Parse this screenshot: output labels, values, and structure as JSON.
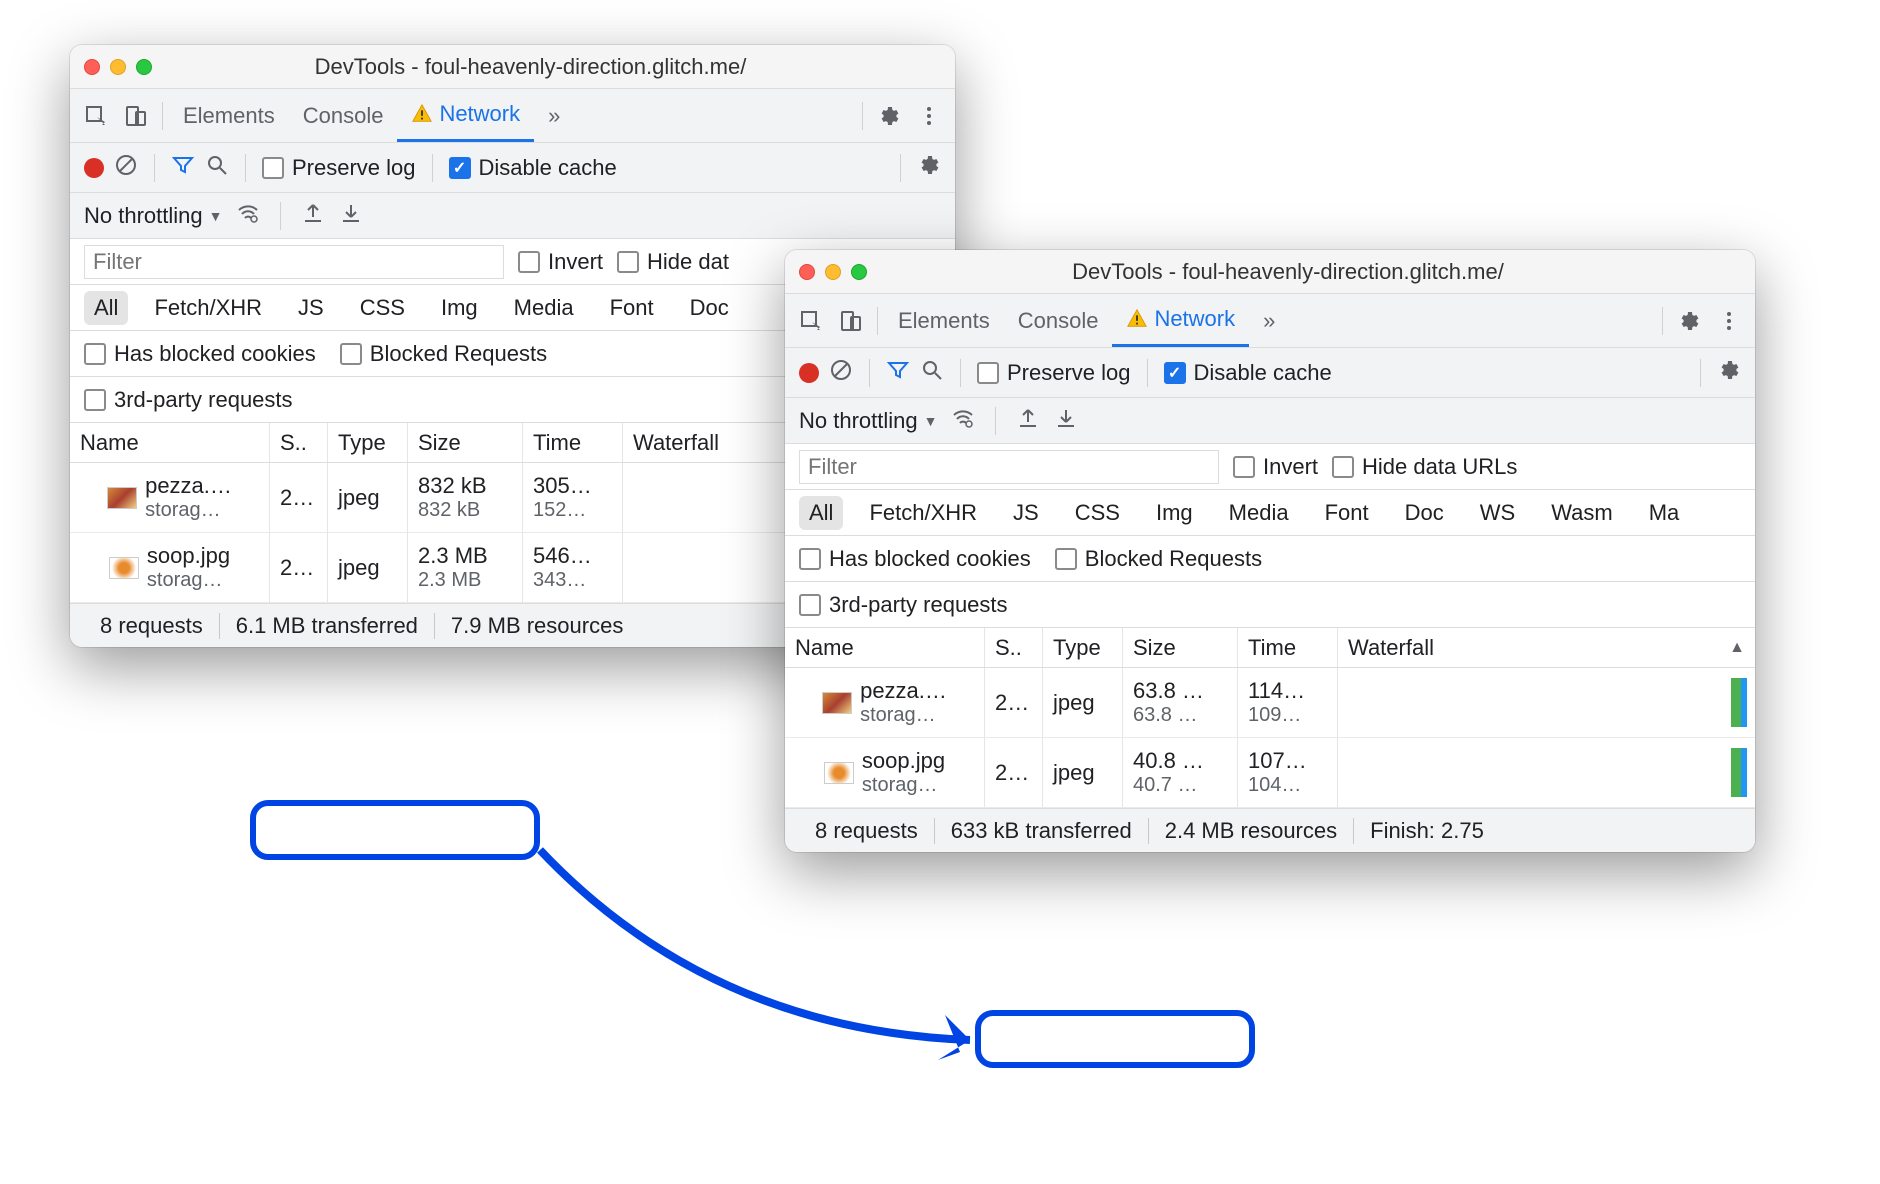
{
  "window_a": {
    "title": "DevTools - foul-heavenly-direction.glitch.me/",
    "tabs": {
      "elements": "Elements",
      "console": "Console",
      "network": "Network",
      "more": "»"
    },
    "toolbar": {
      "preserve_log": "Preserve log",
      "disable_cache": "Disable cache"
    },
    "throttle": {
      "label": "No throttling"
    },
    "filter": {
      "placeholder": "Filter",
      "invert": "Invert",
      "hide_data": "Hide dat"
    },
    "types": {
      "all": "All",
      "fetch": "Fetch/XHR",
      "js": "JS",
      "css": "CSS",
      "img": "Img",
      "media": "Media",
      "font": "Font",
      "doc": "Doc"
    },
    "subchecks": {
      "blocked_cookies": "Has blocked cookies",
      "blocked_requests": "Blocked Requests",
      "third_party": "3rd-party requests"
    },
    "columns": {
      "name": "Name",
      "status": "S..",
      "type": "Type",
      "size": "Size",
      "time": "Time",
      "waterfall": "Waterfall"
    },
    "rows": [
      {
        "name": "pezza.…",
        "domain": "storag…",
        "status": "2…",
        "type": "jpeg",
        "size": "832 kB",
        "size2": "832 kB",
        "time": "305…",
        "time2": "152…"
      },
      {
        "name": "soop.jpg",
        "domain": "storag…",
        "status": "2…",
        "type": "jpeg",
        "size": "2.3 MB",
        "size2": "2.3 MB",
        "time": "546…",
        "time2": "343…"
      }
    ],
    "footer": {
      "requests": "8 requests",
      "transferred": "6.1 MB transferred",
      "resources": "7.9 MB resources"
    }
  },
  "window_b": {
    "title": "DevTools - foul-heavenly-direction.glitch.me/",
    "tabs": {
      "elements": "Elements",
      "console": "Console",
      "network": "Network",
      "more": "»"
    },
    "toolbar": {
      "preserve_log": "Preserve log",
      "disable_cache": "Disable cache"
    },
    "throttle": {
      "label": "No throttling"
    },
    "filter": {
      "placeholder": "Filter",
      "invert": "Invert",
      "hide_data": "Hide data URLs"
    },
    "types": {
      "all": "All",
      "fetch": "Fetch/XHR",
      "js": "JS",
      "css": "CSS",
      "img": "Img",
      "media": "Media",
      "font": "Font",
      "doc": "Doc",
      "ws": "WS",
      "wasm": "Wasm",
      "ma": "Ma"
    },
    "subchecks": {
      "blocked_cookies": "Has blocked cookies",
      "blocked_requests": "Blocked Requests",
      "third_party": "3rd-party requests"
    },
    "columns": {
      "name": "Name",
      "status": "S..",
      "type": "Type",
      "size": "Size",
      "time": "Time",
      "waterfall": "Waterfall"
    },
    "rows": [
      {
        "name": "pezza.…",
        "domain": "storag…",
        "status": "2…",
        "type": "jpeg",
        "size": "63.8 …",
        "size2": "63.8 …",
        "time": "114…",
        "time2": "109…"
      },
      {
        "name": "soop.jpg",
        "domain": "storag…",
        "status": "2…",
        "type": "jpeg",
        "size": "40.8 …",
        "size2": "40.7 …",
        "time": "107…",
        "time2": "104…"
      }
    ],
    "footer": {
      "requests": "8 requests",
      "transferred": "633 kB transferred",
      "resources": "2.4 MB resources",
      "finish": "Finish: 2.75"
    }
  }
}
